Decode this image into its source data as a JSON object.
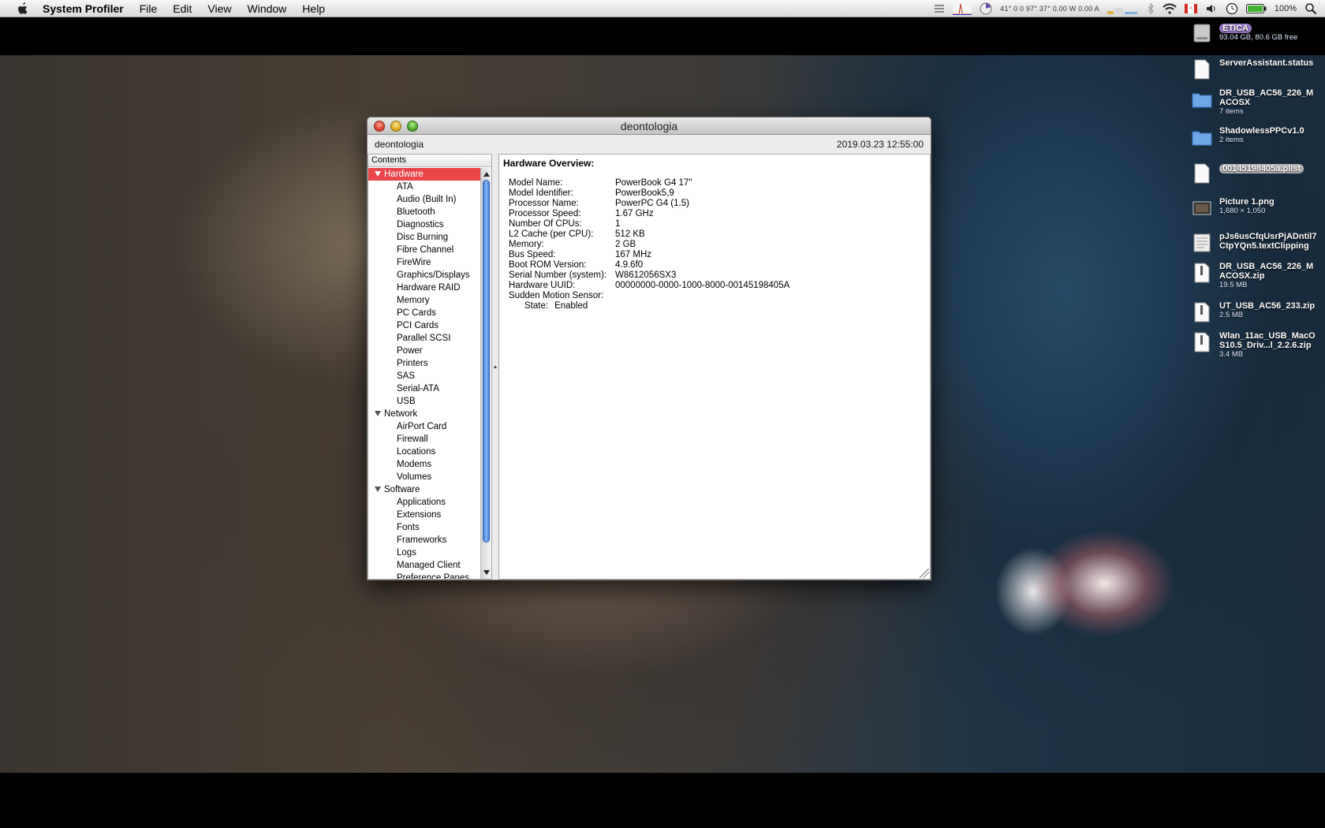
{
  "menubar": {
    "app_name": "System Profiler",
    "items": [
      "File",
      "Edit",
      "View",
      "Window",
      "Help"
    ],
    "status_text": "41° 0 0 97° 37° 0.00 W 0.00 A",
    "battery_percent": "100%"
  },
  "window": {
    "title": "deontologia",
    "computer_name": "deontologia",
    "timestamp": "2019.03.23 12:55:00"
  },
  "sidebar": {
    "header": "Contents",
    "hardware": {
      "label": "Hardware",
      "items": [
        "ATA",
        "Audio (Built In)",
        "Bluetooth",
        "Diagnostics",
        "Disc Burning",
        "Fibre Channel",
        "FireWire",
        "Graphics/Displays",
        "Hardware RAID",
        "Memory",
        "PC Cards",
        "PCI Cards",
        "Parallel SCSI",
        "Power",
        "Printers",
        "SAS",
        "Serial-ATA",
        "USB"
      ]
    },
    "network": {
      "label": "Network",
      "items": [
        "AirPort Card",
        "Firewall",
        "Locations",
        "Modems",
        "Volumes"
      ]
    },
    "software": {
      "label": "Software",
      "items": [
        "Applications",
        "Extensions",
        "Fonts",
        "Frameworks",
        "Logs",
        "Managed Client",
        "Preference Panes"
      ]
    }
  },
  "detail": {
    "title": "Hardware Overview:",
    "rows": [
      {
        "key": "Model Name:",
        "value": "PowerBook G4 17\""
      },
      {
        "key": "Model Identifier:",
        "value": "PowerBook5,9"
      },
      {
        "key": "Processor Name:",
        "value": "PowerPC G4 (1.5)"
      },
      {
        "key": "Processor Speed:",
        "value": "1.67 GHz"
      },
      {
        "key": "Number Of CPUs:",
        "value": "1"
      },
      {
        "key": "L2 Cache (per CPU):",
        "value": "512 KB"
      },
      {
        "key": "Memory:",
        "value": "2 GB"
      },
      {
        "key": "Bus Speed:",
        "value": "167 MHz"
      },
      {
        "key": "Boot ROM Version:",
        "value": "4.9.6f0"
      },
      {
        "key": "Serial Number (system):",
        "value": "W8612056SX3"
      },
      {
        "key": "Hardware UUID:",
        "value": "00000000-0000-1000-8000-00145198405A"
      },
      {
        "key": "Sudden Motion Sensor:",
        "value": ""
      }
    ],
    "sub_row": {
      "key": "State:",
      "value": "Enabled"
    }
  },
  "desktop": {
    "items": [
      {
        "name": "ETICA",
        "info": "93.04 GB, 80.6 GB free",
        "icon": "hard-drive-icon"
      },
      {
        "name": "ServerAssistant.status",
        "info": "",
        "icon": "document-icon"
      },
      {
        "name": "DR_USB_AC56_226_MACOSX",
        "info": "7 items",
        "icon": "folder-icon"
      },
      {
        "name": "ShadowlessPPCv1.0",
        "info": "2 items",
        "icon": "folder-icon"
      },
      {
        "name": "00145198405a.plist",
        "info": "",
        "icon": "document-icon"
      },
      {
        "name": "Picture 1.png",
        "info": "1,680 × 1,050",
        "icon": "image-icon"
      },
      {
        "name": "pJs6usCfqUsrPjADntil7CtpYQn5.textClipping",
        "info": "",
        "icon": "text-clipping-icon"
      },
      {
        "name": "DR_USB_AC56_226_MACOSX.zip",
        "info": "19.5 MB",
        "icon": "zip-icon"
      },
      {
        "name": "UT_USB_AC56_233.zip",
        "info": "2.5 MB",
        "icon": "zip-icon"
      },
      {
        "name": "Wlan_11ac_USB_MacOS10.5_Driv...l_2.2.6.zip",
        "info": "3.4 MB",
        "icon": "zip-icon"
      }
    ]
  }
}
